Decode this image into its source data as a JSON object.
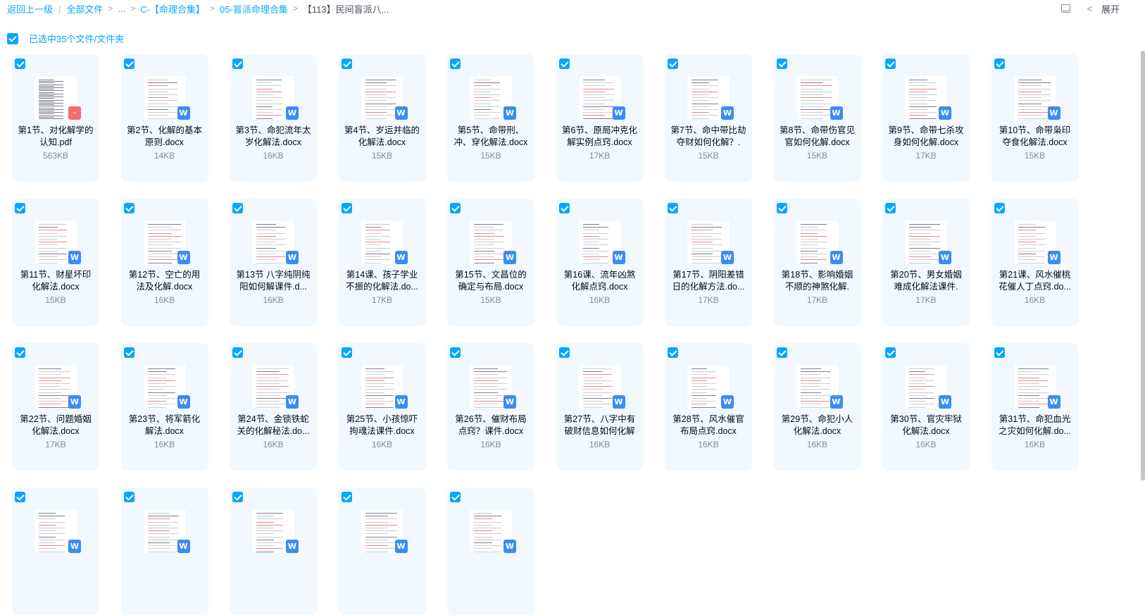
{
  "breadcrumb": {
    "back": "返回上一级",
    "items": [
      "全部文件",
      "...",
      "C-【命理合集】",
      "05-盲派命理合集"
    ],
    "current": "【113】民间盲派八..."
  },
  "toolbar": {
    "expand_label": "展开"
  },
  "selection": {
    "text": "已选中35个文件/文件夹",
    "checked": true
  },
  "files": [
    {
      "name": "第1节、对化解学的认知.pdf",
      "size": "563KB",
      "type": "pdf",
      "checked": true
    },
    {
      "name": "第2节、化解的基本原则.docx",
      "size": "14KB",
      "type": "docx",
      "checked": true
    },
    {
      "name": "第3节、命犯流年太岁化解法.docx",
      "size": "16KB",
      "type": "docx",
      "checked": true
    },
    {
      "name": "第4节、岁运并临的化解法.docx",
      "size": "15KB",
      "type": "docx",
      "checked": true
    },
    {
      "name": "第5节、命带刑、冲、穿化解法.docx",
      "size": "15KB",
      "type": "docx",
      "checked": true
    },
    {
      "name": "第6节、原局冲克化解实例点窍.docx",
      "size": "17KB",
      "type": "docx",
      "checked": true
    },
    {
      "name": "第7节、命中带比劫夺财如何化解？.",
      "size": "15KB",
      "type": "docx",
      "checked": true
    },
    {
      "name": "第8节、命带伤官见官如何化解.docx",
      "size": "15KB",
      "type": "docx",
      "checked": true
    },
    {
      "name": "第9节、命带七杀攻身如何化解.docx",
      "size": "17KB",
      "type": "docx",
      "checked": true
    },
    {
      "name": "第10节、命带枭印夺食化解法.docx",
      "size": "15KB",
      "type": "docx",
      "checked": true
    },
    {
      "name": "第11节、财星坏印化解法.docx",
      "size": "15KB",
      "type": "docx",
      "checked": true
    },
    {
      "name": "第12节、空亡的用法及化解.docx",
      "size": "16KB",
      "type": "docx",
      "checked": true
    },
    {
      "name": "第13节 八字纯阴纯阳如何解课件.d...",
      "size": "16KB",
      "type": "docx",
      "checked": true
    },
    {
      "name": "第14课、孩子学业不振的化解法.do...",
      "size": "17KB",
      "type": "docx",
      "checked": true
    },
    {
      "name": "第15节、文昌位的确定与布局.docx",
      "size": "15KB",
      "type": "docx",
      "checked": true
    },
    {
      "name": "第16课、流年凶煞化解点窍.docx",
      "size": "16KB",
      "type": "docx",
      "checked": true
    },
    {
      "name": "第17节、阴阳差错日的化解方法.do...",
      "size": "17KB",
      "type": "docx",
      "checked": true
    },
    {
      "name": "第18节、影响婚姻不顺的神煞化解.",
      "size": "17KB",
      "type": "docx",
      "checked": true
    },
    {
      "name": "第20节、男女婚姻难成化解法课件.",
      "size": "17KB",
      "type": "docx",
      "checked": true
    },
    {
      "name": "第21课、风水催桃花催人丁点窍.do...",
      "size": "16KB",
      "type": "docx",
      "checked": true
    },
    {
      "name": "第22节、问题婚姻化解法.docx",
      "size": "17KB",
      "type": "docx",
      "checked": true
    },
    {
      "name": "第23节、将军箭化解法.docx",
      "size": "16KB",
      "type": "docx",
      "checked": true
    },
    {
      "name": "第24节、金锁铁蛇关的化解秘法.do...",
      "size": "16KB",
      "type": "docx",
      "checked": true
    },
    {
      "name": "第25节、小孩惊吓拘魂法课件.docx",
      "size": "16KB",
      "type": "docx",
      "checked": true
    },
    {
      "name": "第26节、催财布局点窍？课件.docx",
      "size": "16KB",
      "type": "docx",
      "checked": true
    },
    {
      "name": "第27节、八字中有破财信息如何化解",
      "size": "16KB",
      "type": "docx",
      "checked": true
    },
    {
      "name": "第28节、风水催官布局点窍.docx",
      "size": "16KB",
      "type": "docx",
      "checked": true
    },
    {
      "name": "第29节、命犯小人化解法.docx",
      "size": "16KB",
      "type": "docx",
      "checked": true
    },
    {
      "name": "第30节、官灾牢狱化解法.docx",
      "size": "16KB",
      "type": "docx",
      "checked": true
    },
    {
      "name": "第31节、命犯血光之灾如何化解.do...",
      "size": "16KB",
      "type": "docx",
      "checked": true
    },
    {
      "name": "",
      "size": "",
      "type": "docx",
      "checked": true
    },
    {
      "name": "",
      "size": "",
      "type": "docx",
      "checked": true
    },
    {
      "name": "",
      "size": "",
      "type": "docx",
      "checked": true
    },
    {
      "name": "",
      "size": "",
      "type": "docx",
      "checked": true
    },
    {
      "name": "",
      "size": "",
      "type": "docx",
      "checked": true
    }
  ],
  "icons": {
    "pdf_badge": "pdf-file-icon",
    "docx_badge": "word-file-icon"
  },
  "colors": {
    "accent": "#06a7ff",
    "card_bg": "#f1f9fe",
    "word_badge": "#3d8bf5",
    "pdf_badge": "#f56b6b"
  }
}
